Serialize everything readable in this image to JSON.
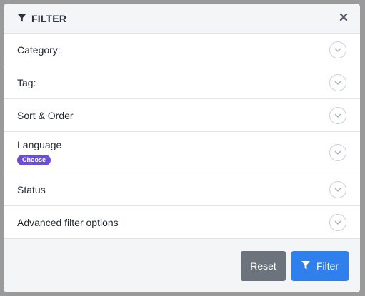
{
  "header": {
    "title": "FILTER",
    "icon": "funnel-icon",
    "close_icon": "close-icon"
  },
  "filters": [
    {
      "label": "Category:",
      "icon": "chevron-down-icon"
    },
    {
      "label": "Tag:",
      "icon": "chevron-down-icon"
    },
    {
      "label": "Sort & Order",
      "icon": "chevron-down-icon"
    },
    {
      "label": "Language",
      "badge": "Choose",
      "icon": "chevron-down-icon"
    },
    {
      "label": "Status",
      "icon": "chevron-down-icon"
    },
    {
      "label": "Advanced filter options",
      "icon": "chevron-down-icon"
    }
  ],
  "footer": {
    "reset_label": "Reset",
    "filter_label": "Filter",
    "filter_icon": "funnel-icon"
  },
  "colors": {
    "primary": "#2f80ed",
    "secondary": "#6c737d",
    "badge": "#6b4fd8"
  }
}
